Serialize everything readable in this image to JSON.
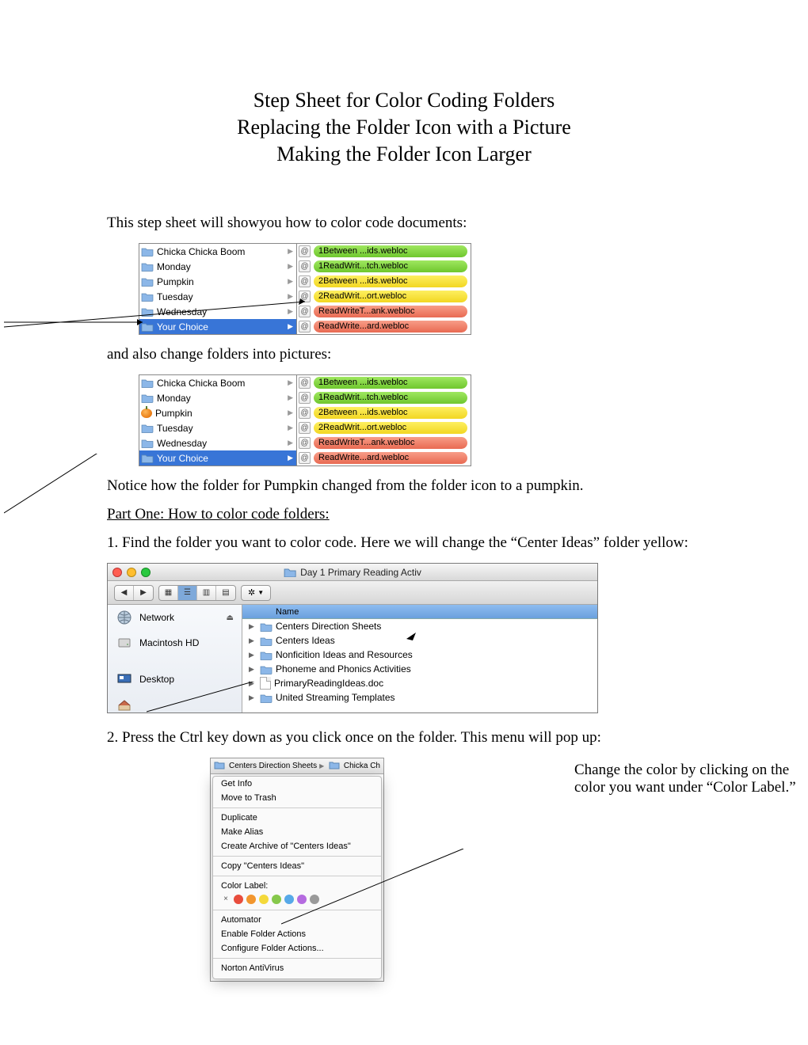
{
  "headings": {
    "h1a": "Step Sheet for Color Coding Folders",
    "h1b": "Replacing the Folder Icon with a Picture",
    "h1c": "Making the Folder Icon Larger"
  },
  "paras": {
    "intro1": "This step sheet will showyou how to color code documents:",
    "intro2": "and also change folders into pictures:",
    "notice": "Notice how the folder for Pumpkin changed from the folder icon to a pumpkin.",
    "part1": "Part One: How to color code folders: ",
    "step1": "1. Find the folder you want to color code. Here we will change the “Center Ideas” folder yellow:",
    "step2": "2. Press the Ctrl key down as you click once on the folder. This menu will pop up:",
    "caption": "Change the color by clicking on the color you want under “Color Label.”"
  },
  "col_left": [
    "Chicka Chicka Boom",
    "Monday",
    "Pumpkin",
    "Tuesday",
    "Wednesday",
    "Your Choice"
  ],
  "col_right": [
    {
      "label": "1Between ...ids.webloc",
      "color": "green"
    },
    {
      "label": "1ReadWrit...tch.webloc",
      "color": "green"
    },
    {
      "label": "2Between ...ids.webloc",
      "color": "yellow"
    },
    {
      "label": "2ReadWrit...ort.webloc",
      "color": "yellow"
    },
    {
      "label": "ReadWriteT...ank.webloc",
      "color": "red"
    },
    {
      "label": "ReadWrite...ard.webloc",
      "color": "red"
    }
  ],
  "finder": {
    "title": "Day 1 Primary Reading Activ",
    "name_hdr": "Name",
    "sidebar": [
      "Network",
      "Macintosh HD",
      "Desktop"
    ],
    "items": [
      {
        "name": "Centers Direction Sheets",
        "type": "folder"
      },
      {
        "name": "Centers Ideas",
        "type": "folder"
      },
      {
        "name": "Nonficition Ideas and Resources",
        "type": "folder"
      },
      {
        "name": "Phoneme and Phonics Activities",
        "type": "folder"
      },
      {
        "name": "PrimaryReadingIdeas.doc",
        "type": "doc"
      },
      {
        "name": "United Streaming Templates",
        "type": "folder"
      }
    ]
  },
  "ctx": {
    "top_left": "Centers Direction Sheets",
    "top_right": "Chicka Ch",
    "items1": [
      "Get Info",
      "Move to Trash"
    ],
    "items2": [
      "Duplicate",
      "Make Alias",
      "Create Archive of \"Centers Ideas\""
    ],
    "items3": [
      "Copy \"Centers Ideas\""
    ],
    "label": "Color Label:",
    "colors": [
      "#e84d3d",
      "#f2962e",
      "#f4d93a",
      "#86c84b",
      "#57a9e8",
      "#b56be0",
      "#9a9a9a"
    ],
    "items4": [
      "Automator",
      "Enable Folder Actions",
      "Configure Folder Actions..."
    ],
    "items5": [
      "Norton AntiVirus"
    ]
  }
}
